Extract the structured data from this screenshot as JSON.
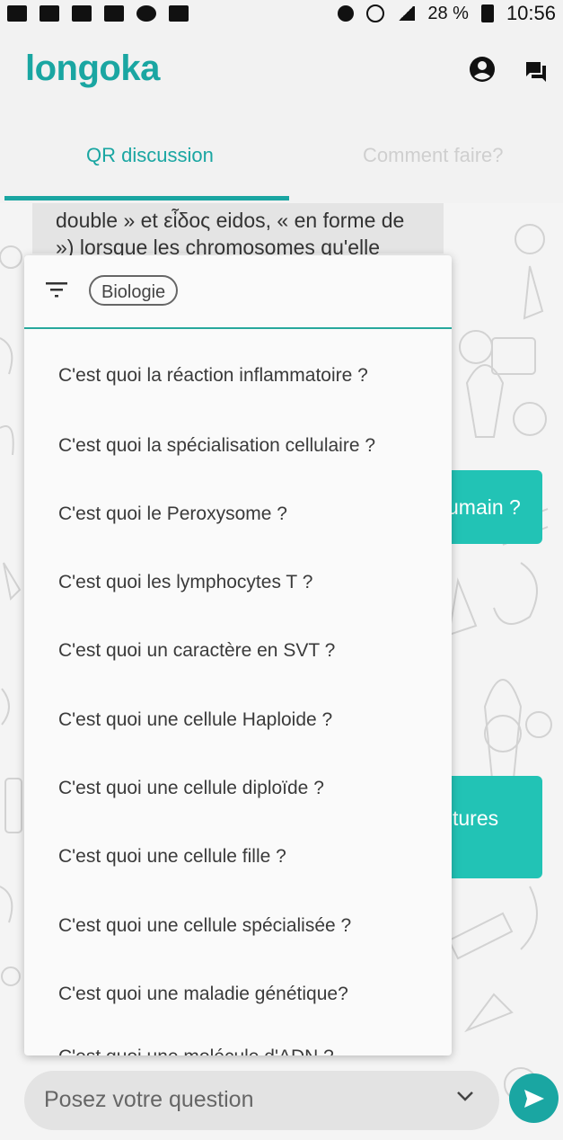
{
  "status": {
    "battery": "28 %",
    "time": "10:56"
  },
  "app": {
    "title": "longoka",
    "account_icon": "account-circle-icon",
    "chat_icon": "chat-icon",
    "accent": "#1aa6a2"
  },
  "tabs": [
    {
      "label": "QR discussion",
      "active": true
    },
    {
      "label": "Comment faire?",
      "active": false
    }
  ],
  "chat": {
    "grey_bubble_lines": [
      "double » et εἶδος eidos, « en forme de",
      "») lorsque les chromosomes qu'elle"
    ],
    "teal_bubble_1": "umain ?",
    "teal_bubble_2": "tures"
  },
  "dropdown": {
    "filter_icon": "filter-icon",
    "chip_label": "Biologie",
    "items": [
      "C'est quoi la réaction inflammatoire ?",
      "C'est quoi la spécialisation cellulaire ?",
      "C'est quoi le Peroxysome ?",
      "C'est quoi les lymphocytes T ?",
      "C'est quoi un caractère en SVT ?",
      "C'est quoi une cellule Haploide ?",
      "C'est quoi une cellule diploïde ?",
      "C'est quoi une cellule fille ?",
      "C'est quoi une cellule spécialisée ?",
      "C'est quoi une maladie génétique?",
      "C'est quoi une molécule d'ADN ?"
    ]
  },
  "input": {
    "placeholder": "Posez votre question"
  }
}
